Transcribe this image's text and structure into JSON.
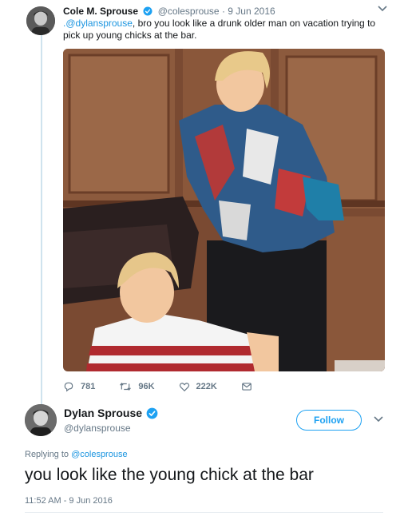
{
  "reply_tweet": {
    "author_name": "Cole M. Sprouse",
    "handle": "@colesprouse",
    "separator": "·",
    "date": "9 Jun 2016",
    "text_mention": ".@dylansprouse",
    "text_rest": ", bro you look like a drunk older man on vacation trying to pick up young chicks at the bar.",
    "actions": {
      "replies": "781",
      "retweets": "96K",
      "likes": "222K"
    }
  },
  "main_tweet": {
    "author_name": "Dylan Sprouse",
    "handle": "@dylansprouse",
    "follow_label": "Follow",
    "replying_prefix": "Replying to ",
    "replying_handle": "@colesprouse",
    "text": "you look like the young chick at the bar",
    "timestamp": "11:52 AM - 9 Jun 2016"
  },
  "colors": {
    "accent": "#1da1f2",
    "link": "#1b95e0",
    "muted": "#657786",
    "thread_line": "#cfe3ee"
  },
  "icons": [
    "verified-badge-icon",
    "chevron-down-icon",
    "reply-icon",
    "retweet-icon",
    "like-icon",
    "message-icon"
  ]
}
